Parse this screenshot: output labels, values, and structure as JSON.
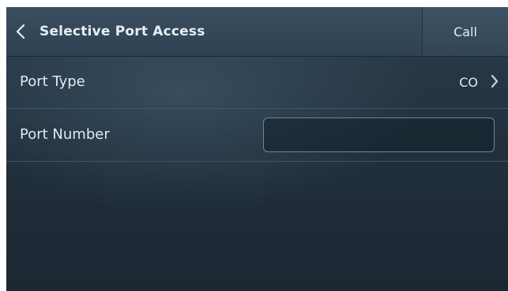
{
  "header": {
    "title": "Selective Port Access",
    "back_icon": "chevron-left-icon",
    "call_label": "Call"
  },
  "rows": {
    "port_type": {
      "label": "Port Type",
      "value": "CO",
      "icon": "chevron-right-icon"
    },
    "port_number": {
      "label": "Port Number",
      "value": "",
      "placeholder": ""
    }
  },
  "colors": {
    "background_top": "#2b3c4b",
    "background_bottom": "#1b2732",
    "header": "#3a4e5f",
    "text": "#e6edf3",
    "divider": "#3f5565",
    "input_border": "#6f8599"
  }
}
